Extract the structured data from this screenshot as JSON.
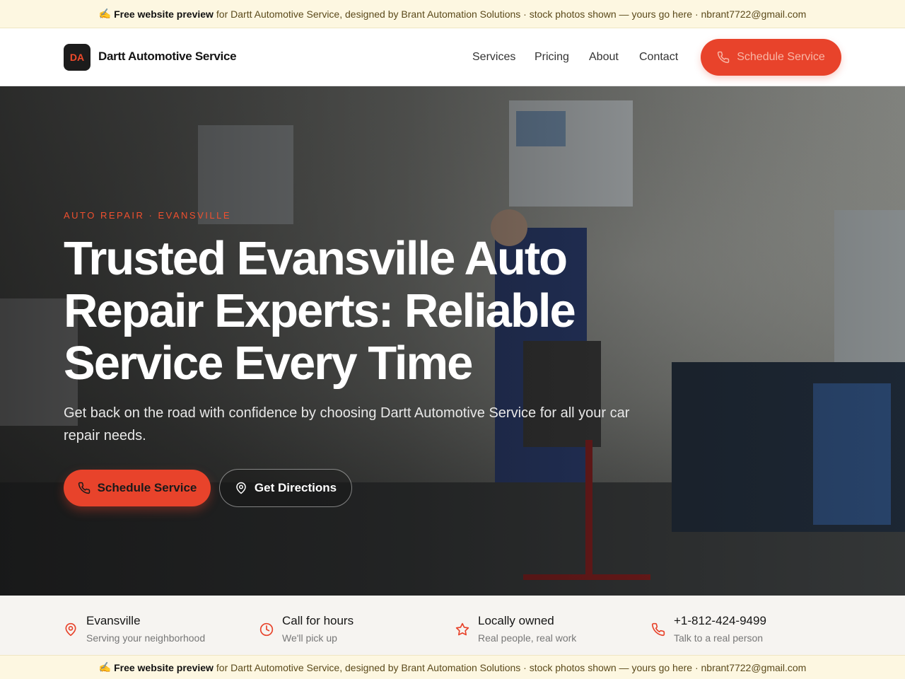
{
  "banner": {
    "icon": "writing-hand-icon",
    "bold": "Free website preview",
    "text": "for Dartt Automotive Service, designed by Brant Automation Solutions · stock photos shown — yours go here · nbrant7722@gmail.com"
  },
  "nav": {
    "logo_initials": "DA",
    "brand": "Dartt Automotive Service",
    "links": [
      "Services",
      "Pricing",
      "About",
      "Contact"
    ],
    "cta": "Schedule Service"
  },
  "hero": {
    "eyebrow": "AUTO REPAIR · EVANSVILLE",
    "headline": "Trusted Evansville Auto Repair Experts: Reliable Service Every Time",
    "subheadline": "Get back on the road with confidence by choosing Dartt Automotive Service for all your car repair needs.",
    "primary_button": "Schedule Service",
    "secondary_button": "Get Directions"
  },
  "features": [
    {
      "icon": "map-pin-icon",
      "title": "Evansville",
      "subtitle": "Serving your neighborhood"
    },
    {
      "icon": "clock-icon",
      "title": "Call for hours",
      "subtitle": "We'll pick up"
    },
    {
      "icon": "star-icon",
      "title": "Locally owned",
      "subtitle": "Real people, real work"
    },
    {
      "icon": "phone-icon",
      "title": "+1-812-424-9499",
      "subtitle": "Talk to a real person"
    }
  ],
  "colors": {
    "accent": "#e8432b",
    "banner_bg": "#fdf7e1",
    "dark": "#1c1c1c",
    "strip_bg": "#f6f4f1"
  }
}
